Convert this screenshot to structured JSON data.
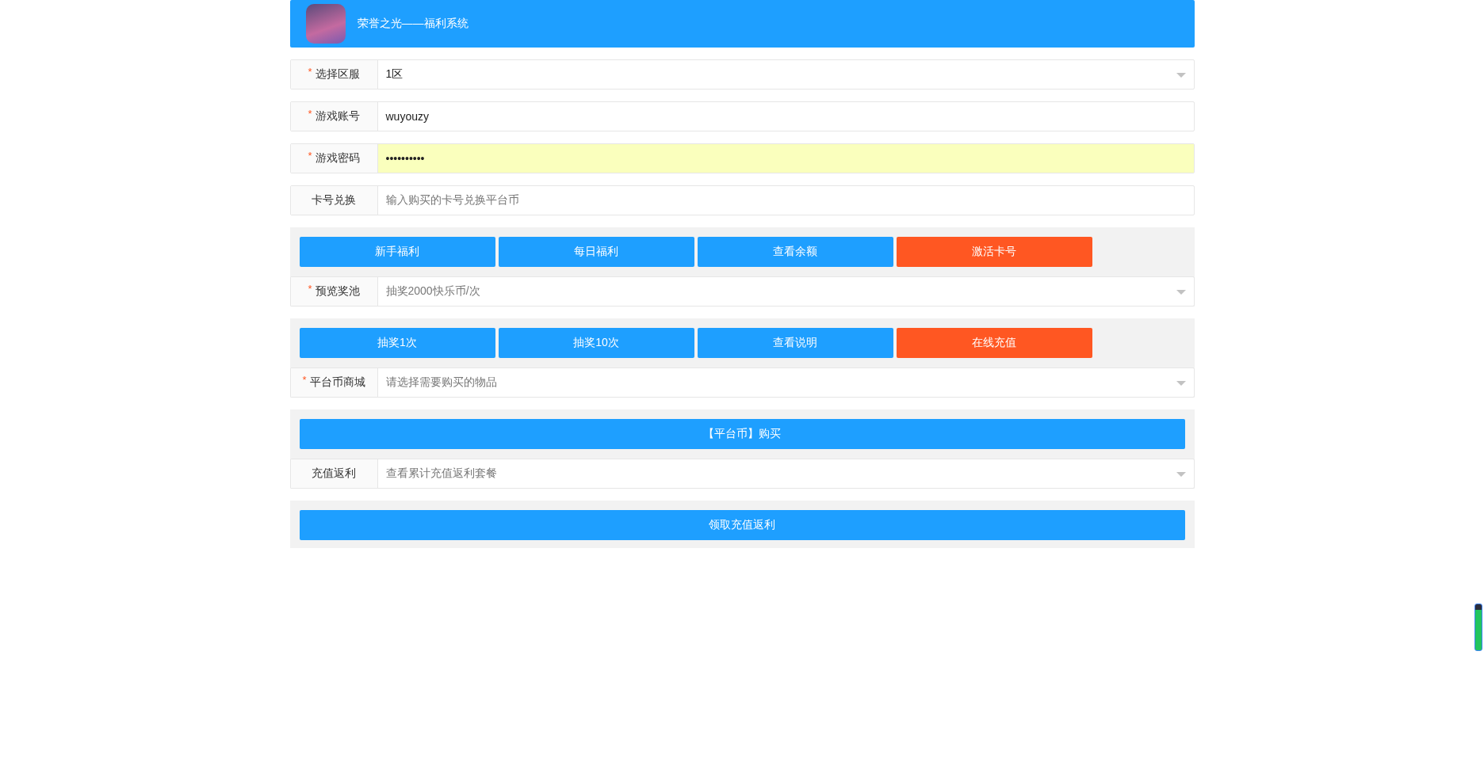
{
  "header": {
    "title": "荣誉之光——福利系统"
  },
  "blocks": [
    {
      "kind": "select",
      "label": "选择区服",
      "required_mark": "*",
      "value": "1区",
      "autofilled": false
    },
    {
      "kind": "text",
      "label": "游戏账号",
      "required_mark": "*",
      "value": "wuyouzy",
      "autofilled": false
    },
    {
      "kind": "text",
      "label": "游戏密码",
      "required_mark": "*",
      "value": "••••••••••",
      "autofilled": true
    },
    {
      "kind": "text",
      "label": "卡号兑换",
      "placeholder": "输入购买的卡号兑换平台币",
      "autofilled": false
    },
    {
      "kind": "panel",
      "wide": false,
      "buttons": [
        {
          "label": "新手福利",
          "color": "#1e9fff"
        },
        {
          "label": "每日福利",
          "color": "#1e9fff"
        },
        {
          "label": "查看余额",
          "color": "#1e9fff"
        },
        {
          "label": "激活卡号",
          "color": "#ff5722"
        }
      ],
      "field": {
        "kind": "select",
        "label": "预览奖池",
        "required_mark": "*",
        "placeholder": "抽奖2000快乐币/次",
        "autofilled": false
      }
    },
    {
      "kind": "panel",
      "wide": false,
      "buttons": [
        {
          "label": "抽奖1次",
          "color": "#1e9fff"
        },
        {
          "label": "抽奖10次",
          "color": "#1e9fff"
        },
        {
          "label": "查看说明",
          "color": "#1e9fff"
        },
        {
          "label": "在线充值",
          "color": "#ff5722"
        }
      ],
      "field": {
        "kind": "select",
        "label": "平台币商城",
        "required_mark": "*",
        "placeholder": "请选择需要购买的物品",
        "autofilled": false
      }
    },
    {
      "kind": "panel",
      "wide": true,
      "buttons": [
        {
          "label": "【平台币】购买",
          "color": "#1e9fff"
        }
      ],
      "field": {
        "kind": "select",
        "label": "充值返利",
        "placeholder": "查看累计充值返利套餐",
        "autofilled": false
      }
    },
    {
      "kind": "panel",
      "wide": true,
      "buttons": [
        {
          "label": "领取充值返利",
          "color": "#1e9fff"
        }
      ]
    }
  ]
}
